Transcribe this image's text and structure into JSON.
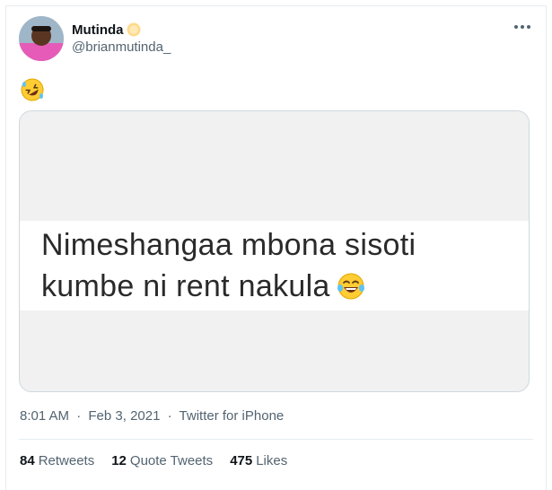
{
  "tweet": {
    "display_name": "Mutinda",
    "handle": "@brianmutinda_",
    "timestamp": "8:01 AM",
    "date": "Feb 3, 2021",
    "source": "Twitter for iPhone",
    "separator": "·"
  },
  "media": {
    "line1": "Nimeshangaa mbona sisoti",
    "line2": "kumbe ni rent nakula"
  },
  "stats": {
    "retweets_count": "84",
    "retweets_label": "Retweets",
    "quotes_count": "12",
    "quotes_label": "Quote Tweets",
    "likes_count": "475",
    "likes_label": "Likes"
  },
  "icons": {
    "badge": "sun-emoji-icon",
    "tweet_body": "rolling-on-floor-laughing-icon",
    "media_emoji": "tears-of-joy-icon",
    "menu": "more-options-icon"
  },
  "colors": {
    "secondary_text": "#536471",
    "primary_text": "#0f1419",
    "border": "#e6ecf0"
  }
}
